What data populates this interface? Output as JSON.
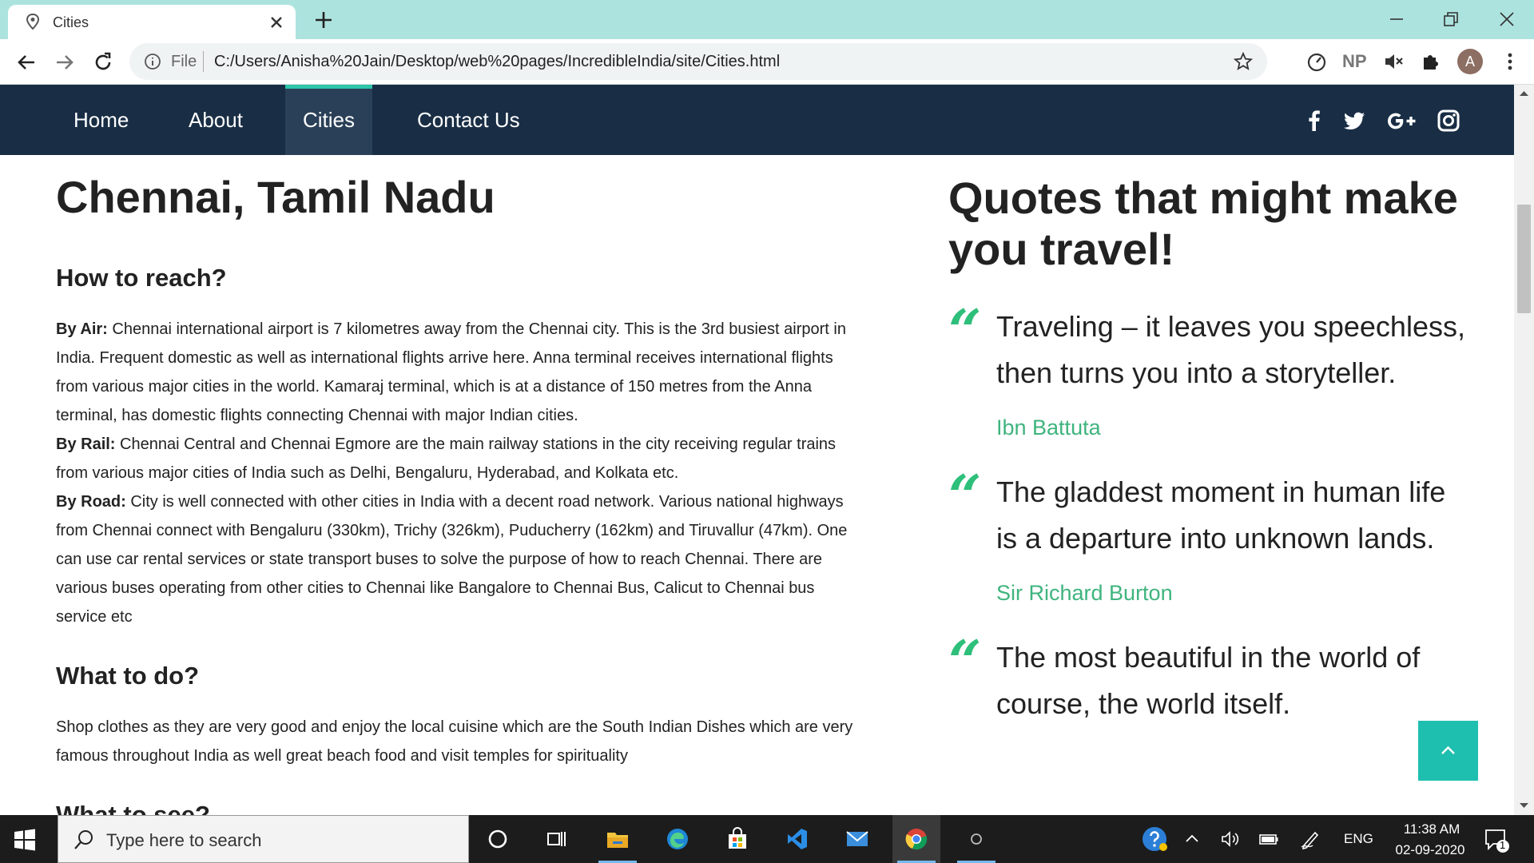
{
  "browser": {
    "tab_title": "Cities",
    "address_file_label": "File",
    "url": "C:/Users/Anisha%20Jain/Desktop/web%20pages/IncredibleIndia/site/Cities.html",
    "ext_np_label": "NP",
    "avatar_letter": "A"
  },
  "nav": {
    "items": [
      {
        "label": "Home"
      },
      {
        "label": "About"
      },
      {
        "label": "Cities"
      },
      {
        "label": "Contact Us"
      }
    ],
    "active_item": "Cities",
    "social_icons": [
      "facebook-icon",
      "twitter-icon",
      "google-plus-icon",
      "instagram-icon"
    ]
  },
  "city": {
    "title": "Chennai, Tamil Nadu",
    "how_heading": "How to reach?",
    "air_label": "By Air:",
    "air_text": "Chennai international airport is 7 kilometres away from the Chennai city. This is the 3rd busiest airport in India. Frequent domestic as well as international flights arrive here. Anna terminal receives international flights from various major cities in the world. Kamaraj terminal, which is at a distance of 150 metres from the Anna terminal, has domestic flights connecting Chennai with major Indian cities.",
    "rail_label": "By Rail:",
    "rail_text": "Chennai Central and Chennai Egmore are the main railway stations in the city receiving regular trains from various major cities of India such as Delhi, Bengaluru, Hyderabad, and Kolkata etc.",
    "road_label": "By Road:",
    "road_text": "City is well connected with other cities in India with a decent road network. Various national highways from Chennai connect with Bengaluru (330km), Trichy (326km), Puducherry (162km) and Tiruvallur (47km). One can use car rental services or state transport buses to solve the purpose of how to reach Chennai. There are various buses operating from other cities to Chennai like Bangalore to Chennai Bus, Calicut to Chennai bus service etc",
    "do_heading": "What to do?",
    "do_text": "Shop clothes as they are very good and enjoy the local cuisine which are the South Indian Dishes which are very famous throughout India as well great beach food and visit temples for spirituality",
    "see_heading": "What to see?"
  },
  "quotes": {
    "title": "Quotes that might make you travel!",
    "items": [
      {
        "text": "Traveling – it leaves you speechless, then turns you into a storyteller.",
        "author": "Ibn Battuta"
      },
      {
        "text": "The gladdest moment in human life is a departure into unknown lands.",
        "author": "Sir Richard Burton"
      },
      {
        "text": "The most beautiful in the world of course, the world itself.",
        "author": ""
      }
    ],
    "quote_mark": "“"
  },
  "taskbar": {
    "search_placeholder": "Type here to search",
    "language": "ENG",
    "time": "11:38 AM",
    "date": "02-09-2020",
    "notification_count": "1"
  },
  "colors": {
    "nav_bg": "#192e45",
    "accent_green": "#2ebf7a",
    "back_to_top": "#1fbfb0",
    "tab_strip": "#ade3df"
  }
}
